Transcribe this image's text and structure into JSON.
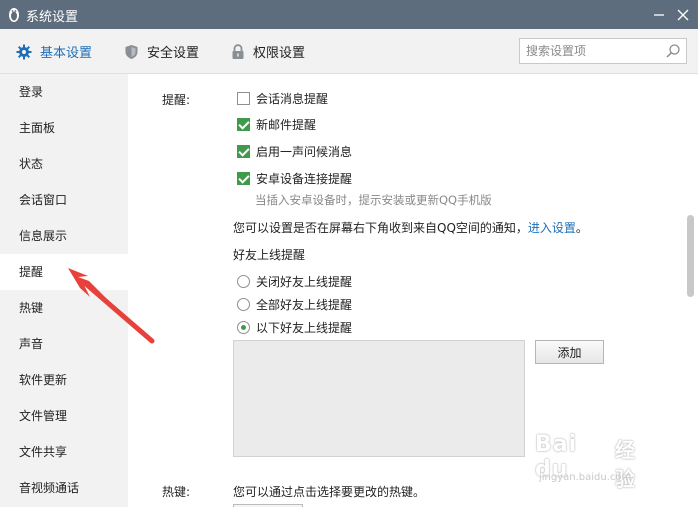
{
  "window": {
    "title": "系统设置"
  },
  "tabs": [
    {
      "label": "基本设置",
      "active": true
    },
    {
      "label": "安全设置",
      "active": false
    },
    {
      "label": "权限设置",
      "active": false
    }
  ],
  "search": {
    "placeholder": "搜索设置项"
  },
  "sidebar": {
    "items": [
      {
        "label": "登录"
      },
      {
        "label": "主面板"
      },
      {
        "label": "状态"
      },
      {
        "label": "会话窗口"
      },
      {
        "label": "信息展示"
      },
      {
        "label": "提醒",
        "active": true
      },
      {
        "label": "热键"
      },
      {
        "label": "声音"
      },
      {
        "label": "软件更新"
      },
      {
        "label": "文件管理"
      },
      {
        "label": "文件共享"
      },
      {
        "label": "音视频通话"
      }
    ]
  },
  "reminder": {
    "section_label": "提醒:",
    "checkboxes": [
      {
        "label": "会话消息提醒",
        "checked": false
      },
      {
        "label": "新邮件提醒",
        "checked": true
      },
      {
        "label": "启用一声问候消息",
        "checked": true
      },
      {
        "label": "安卓设备连接提醒",
        "checked": true
      }
    ],
    "android_hint": "当插入安卓设备时，提示安装或更新QQ手机版",
    "qzone_text": "您可以设置是否在屏幕右下角收到来自QQ空间的通知，",
    "qzone_link": "进入设置",
    "qzone_end": "。",
    "friend_online_title": "好友上线提醒",
    "radios": [
      {
        "label": "关闭好友上线提醒",
        "checked": false
      },
      {
        "label": "全部好友上线提醒",
        "checked": false
      },
      {
        "label": "以下好友上线提醒",
        "checked": true
      }
    ],
    "add_button": "添加"
  },
  "hotkey": {
    "section_label": "热键:",
    "description": "您可以通过点击选择要更改的热键。"
  },
  "watermark": {
    "logo": "Bai du",
    "cn": "经验",
    "url": "jingyan.baidu.com"
  },
  "colors": {
    "titlebar": "#5d6d7d",
    "accent": "#1f6fb8",
    "check_green": "#3f9b4b",
    "arrow_red": "#e8403a"
  },
  "icons": {
    "app": "penguin-icon",
    "basic_tab": "gear-icon",
    "security_tab": "shield-icon",
    "perm_tab": "lock-icon",
    "search": "search-icon",
    "minimize": "minimize-icon",
    "close": "close-icon"
  }
}
